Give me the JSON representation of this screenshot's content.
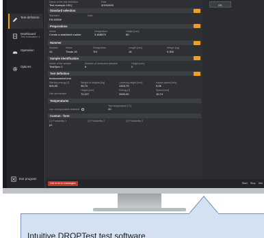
{
  "sidebar": {
    "items": [
      {
        "label": "",
        "sub": ""
      },
      {
        "label": "Test definition",
        "sub": ""
      },
      {
        "label": "Dashboard",
        "sub": "Test evaluation 1"
      },
      {
        "label": "Operation",
        "sub": ""
      },
      {
        "label": "Options",
        "sub": ""
      }
    ],
    "exit_label": "Exit program"
  },
  "top": {
    "name_label": "Name of the test definition",
    "name_value": "Test example 100.j",
    "date_label": "Date",
    "date_value": "3/19/2020"
  },
  "sections": {
    "standard": {
      "title": "Standard selection",
      "standard_label": "Standard",
      "standard_value": "EN 60068",
      "note_label": "Note"
    },
    "preparations": {
      "title": "Preparations",
      "name_label": "Name",
      "name_value": "Create a stabilised marker",
      "designation_label": "Designation",
      "designation_value": "3.465879",
      "height_label": "Height [mm]",
      "height_value": "50"
    },
    "hammer": {
      "title": "Hammer",
      "number_label": "Number",
      "number_value": "10",
      "name_label": "Name",
      "name_value": "Thuds 16",
      "designation_label": "Designation",
      "designation_value": "Tr4",
      "length_label": "Length [mm]",
      "length_value": "18",
      "weight_label": "Weight [kg]",
      "weight_value": "0,300"
    },
    "sample": {
      "title": "Sample identification",
      "name_label": "Name of the sample",
      "name_value": "TestSpec 1",
      "count_label": "Number of measured samples",
      "count_value": "8",
      "height_label": "Height [mm]",
      "height_value": "2"
    },
    "test_definition": {
      "title": "Test definition",
      "subtitle": "Instrumented test",
      "f1_label": "Starting energy [J]",
      "f1_value": "500,00",
      "f2_label": "Weight of weights [kg]",
      "f2_value": "38,70",
      "f3_label": "Lowering height [mm]",
      "f3_value": "1315,79",
      "f4_label": "Impact speed [m/s]",
      "f4_value": "5,08",
      "f5_label": "Height [mm]",
      "f5_value": "72,227",
      "f6_label": "Energy [J]",
      "f6_value": "2000,00",
      "f7_label": "Speed [m/s]",
      "f7_value": "10,74",
      "accel_label": "Use accelerator",
      "accel_value": ""
    },
    "temperature": {
      "title": "Temperatures",
      "chamber_label": "Use a temperature chamber",
      "temp_label": "Test temperature [°C]",
      "temp_value": "20"
    },
    "custom": {
      "title": "Custom - form",
      "c1_label": "(1) Probability 1",
      "c1_value": "p1",
      "c2_label": "(2) Probability 2",
      "c3_label": "(3) Probability 3"
    }
  },
  "right": {
    "ok_label": "OK"
  },
  "status": {
    "error_label": "List of error messages",
    "right_items": [
      "Start",
      "Stop",
      "Info"
    ]
  },
  "callout": {
    "text": "Intuitive DROPTest test software"
  },
  "colors": {
    "accent": "#f29e1f",
    "error": "#c0392b",
    "callout_bg": "#d4e1f0"
  }
}
